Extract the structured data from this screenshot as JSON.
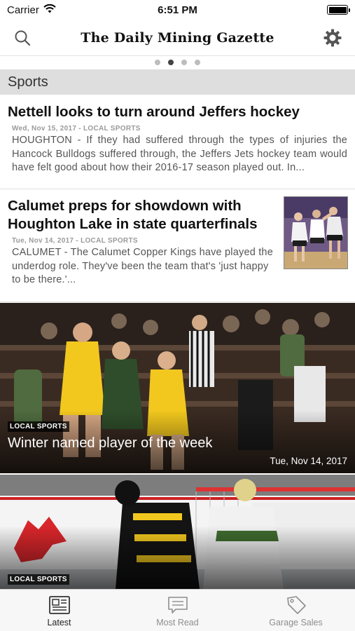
{
  "status_bar": {
    "carrier": "Carrier",
    "time": "6:51 PM"
  },
  "header": {
    "masthead": "The Daily Mining Gazette"
  },
  "pager": {
    "count": 4,
    "active_index": 1
  },
  "section": {
    "title": "Sports"
  },
  "articles": [
    {
      "title": "Nettell looks to turn around Jeffers hockey",
      "meta": "Wed, Nov 15, 2017 - LOCAL SPORTS",
      "summary": "HOUGHTON - If they had suffered through the types of injuries the Hancock Bulldogs suffered through, the Jeffers Jets hockey team would have felt good about how their 2016-17 season played out. In..."
    },
    {
      "title": "Calumet preps for showdown with Houghton Lake in state quarterfinals",
      "meta": "Tue, Nov 14, 2017 - LOCAL SPORTS",
      "summary": "CALUMET - The Calumet Copper Kings have played the underdog role. They've been the team that's 'just happy to be there.'..."
    }
  ],
  "features": [
    {
      "tag": "LOCAL SPORTS",
      "title": "Winter named player of the week",
      "date": "Tue, Nov 14, 2017"
    },
    {
      "tag": "LOCAL SPORTS"
    }
  ],
  "tabs": [
    {
      "label": "Latest",
      "icon": "newspaper-icon",
      "active": true
    },
    {
      "label": "Most Read",
      "icon": "chat-bubble-icon",
      "active": false
    },
    {
      "label": "Garage Sales",
      "icon": "price-tag-icon",
      "active": false
    }
  ],
  "colors": {
    "section_bg": "#dedede",
    "tab_active": "#222222",
    "tab_inactive": "#8e8e8e",
    "team_yellow": "#f2c81e",
    "team_green": "#2f4d2a"
  }
}
